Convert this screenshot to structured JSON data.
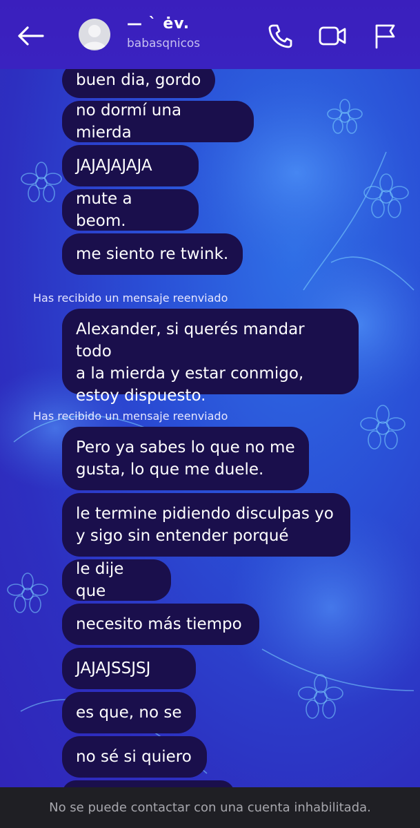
{
  "header": {
    "name": "— ` ėv.",
    "username": "babasqnicos"
  },
  "messages": [
    {
      "text": "buen dia, gordo"
    },
    {
      "text": "no dormí una mierda"
    },
    {
      "text": "JAJAJAJAJA"
    },
    {
      "text": "mute a beom."
    },
    {
      "text": "me siento re twink."
    },
    {
      "forward_label": "Has recibido un mensaje reenviado"
    },
    {
      "line1": "Alexander, si querés mandar todo",
      "line2": "a la mierda y estar conmigo,",
      "line3": "estoy dispuesto."
    },
    {
      "forward_label": "Has recibido un mensaje reenviado"
    },
    {
      "line1": "Pero ya sabes lo que no me",
      "line2": "gusta, lo que me duele."
    },
    {
      "line1": "le termine pidiendo disculpas yo",
      "line2": "y sigo sin entender porqué"
    },
    {
      "text": "le dije que"
    },
    {
      "text": "necesito más tiempo"
    },
    {
      "text": "JAJAJSSJSJ"
    },
    {
      "text": "es que, no se"
    },
    {
      "text": "no sé si quiero"
    }
  ],
  "footer": {
    "notice": "No se puede contactar con una cuenta inhabilitada."
  },
  "colors": {
    "bubble": "#1a0f4c",
    "header": "#3a1fbd",
    "footer": "#1f1f24"
  },
  "icons": [
    "back-arrow-icon",
    "avatar-placeholder",
    "phone-icon",
    "video-icon",
    "flag-icon"
  ]
}
